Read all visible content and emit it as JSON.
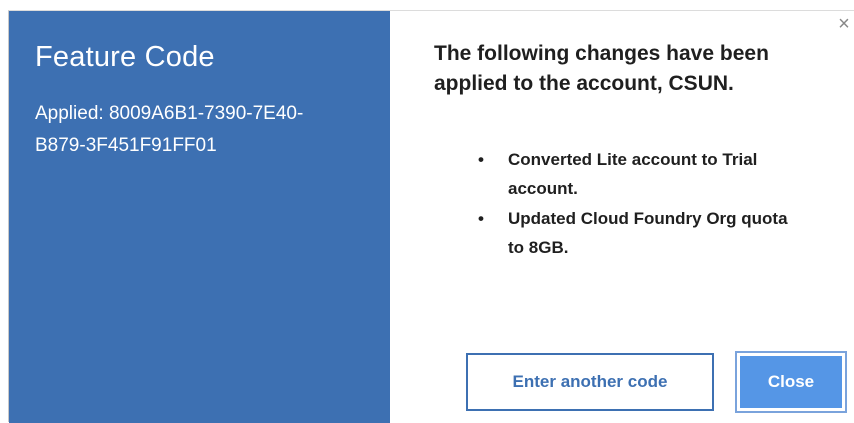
{
  "left_panel": {
    "title": "Feature Code",
    "applied_text": "Applied: 8009A6B1-7390-7E40-B879-3F451F91FF01"
  },
  "right_panel": {
    "heading": "The following changes have been applied to the account, CSUN.",
    "changes": [
      "Converted Lite account to Trial account.",
      "Updated Cloud Foundry Org quota to 8GB."
    ],
    "close_icon_glyph": "×"
  },
  "buttons": {
    "enter_another_code": "Enter another code",
    "close": "Close"
  },
  "colors": {
    "left_panel_bg": "#3d70b2",
    "primary_button": "#5596e6",
    "secondary_border": "#3d70b2"
  }
}
